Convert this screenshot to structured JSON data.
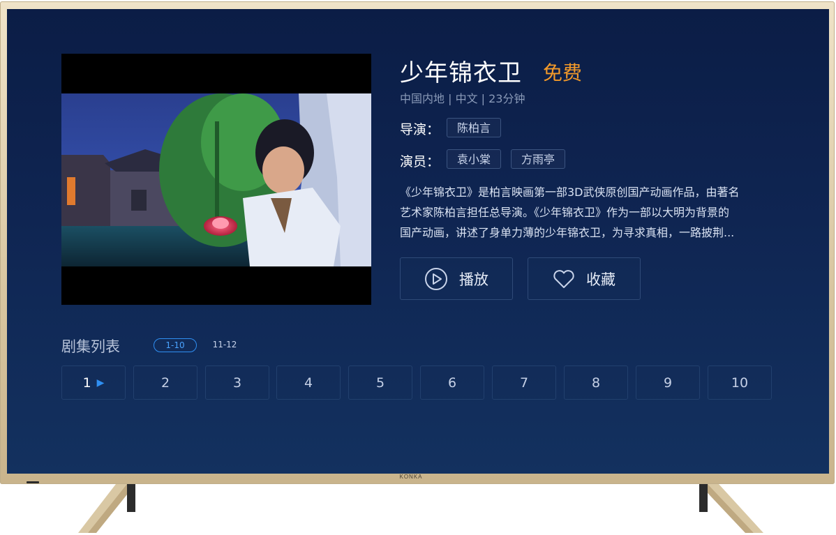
{
  "show": {
    "title": "少年锦衣卫",
    "badge": "免费",
    "meta": "中国内地 | 中文 | 23分钟",
    "director_label": "导演：",
    "directors": [
      "陈柏言"
    ],
    "cast_label": "演员：",
    "cast": [
      "袁小棠",
      "方雨亭"
    ],
    "description_lines": [
      "《少年锦衣卫》是柏言映画第一部3D武侠原创国产动画作品，由著名",
      "艺术家陈柏言担任总导演。《少年锦衣卫》作为一部以大明为背景的",
      "国产动画，讲述了身单力薄的少年锦衣卫，为寻求真相，一路披荆..."
    ]
  },
  "actions": {
    "play_label": "播放",
    "favorite_label": "收藏"
  },
  "episodes": {
    "title": "剧集列表",
    "ranges": [
      "1-10",
      "11-12"
    ],
    "active_range": "1-10",
    "items": [
      "1",
      "2",
      "3",
      "4",
      "5",
      "6",
      "7",
      "8",
      "9",
      "10"
    ],
    "current": "1"
  },
  "tv": {
    "brand": "KONKA"
  },
  "colors": {
    "accent": "#2f8ff2",
    "free_badge": "#f39a2a",
    "screen_bg": "#0f2552"
  }
}
